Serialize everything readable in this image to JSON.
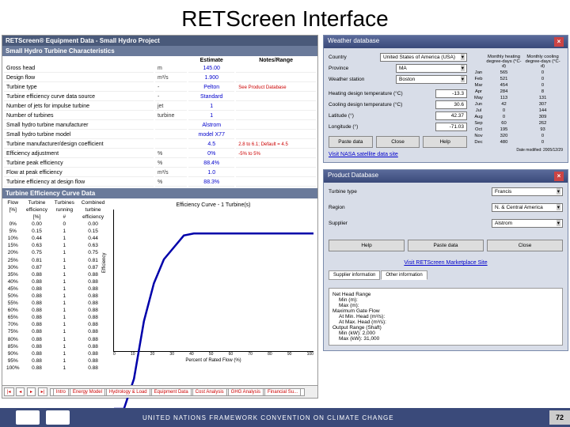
{
  "title": "RETScreen Interface",
  "left_panel": {
    "header": "RETScreen® Equipment Data - Small Hydro Project",
    "section1": "Small Hydro Turbine Characteristics",
    "cols": [
      "",
      "",
      "Estimate",
      "Notes/Range"
    ],
    "rows": [
      {
        "label": "Gross head",
        "unit": "m",
        "val": "145.00",
        "note": ""
      },
      {
        "label": "Design flow",
        "unit": "m³/s",
        "val": "1.900",
        "note": ""
      },
      {
        "label": "Turbine type",
        "unit": "-",
        "val": "Pelton",
        "note": "See Product Database"
      },
      {
        "label": "Turbine efficiency curve data source",
        "unit": "-",
        "val": "Standard",
        "note": ""
      },
      {
        "label": "Number of jets for impulse turbine",
        "unit": "jet",
        "val": "1",
        "note": ""
      },
      {
        "label": "Number of turbines",
        "unit": "turbine",
        "val": "1",
        "note": ""
      },
      {
        "label": "Small hydro turbine manufacturer",
        "unit": "",
        "val": "Alstrom",
        "note": ""
      },
      {
        "label": "Small hydro turbine model",
        "unit": "",
        "val": "model X77",
        "note": ""
      },
      {
        "label": "Turbine manufacturer/design coefficient",
        "unit": "",
        "val": "4.5",
        "note": "2.8 to 6.1; Default = 4.5"
      },
      {
        "label": "Efficiency adjustment",
        "unit": "%",
        "val": "0%",
        "note": "-5% to 5%"
      },
      {
        "label": "Turbine peak efficiency",
        "unit": "%",
        "val": "88.4%",
        "note": ""
      },
      {
        "label": "Flow at peak efficiency",
        "unit": "m³/s",
        "val": "1.0",
        "note": ""
      },
      {
        "label": "Turbine efficiency at design flow",
        "unit": "%",
        "val": "88.3%",
        "note": ""
      }
    ],
    "section2": "Turbine Efficiency Curve Data",
    "eff_headers": [
      "Flow",
      "Turbine",
      "Turbines",
      "Combined"
    ],
    "eff_sub": [
      "[%]",
      "efficiency",
      "running",
      "turbine"
    ],
    "eff_sub2": [
      "",
      "[%]",
      "#",
      "efficiency"
    ],
    "tabs": [
      "Intro",
      "Energy Model",
      "Hydrology & Load",
      "Equipment Data",
      "Cost Analysis",
      "GHG Analysis",
      "Financial Su..."
    ]
  },
  "chart_data": {
    "type": "line",
    "title": "Efficiency Curve - 1 Turbine(s)",
    "xlabel": "Percent of Rated Flow (%)",
    "ylabel": "Efficiency",
    "xlim": [
      0,
      100
    ],
    "ylim": [
      0,
      100
    ],
    "x": [
      0,
      5,
      10,
      15,
      20,
      25,
      30,
      35,
      40,
      45,
      50,
      55,
      60,
      65,
      70,
      75,
      80,
      85,
      90,
      95,
      100
    ],
    "y": [
      0,
      0.0,
      0.15,
      0.44,
      0.63,
      0.75,
      0.81,
      0.87,
      0.88,
      0.88,
      0.88,
      0.88,
      0.88,
      0.88,
      0.88,
      0.88,
      0.88,
      0.88,
      0.88,
      0.88,
      0.88
    ],
    "eff_table": [
      [
        0,
        0.0,
        0,
        0.0
      ],
      [
        5,
        0.15,
        1,
        0.15
      ],
      [
        10,
        0.44,
        1,
        0.44
      ],
      [
        15,
        0.63,
        1,
        0.63
      ],
      [
        20,
        0.75,
        1,
        0.75
      ],
      [
        25,
        0.81,
        1,
        0.81
      ],
      [
        30,
        0.87,
        1,
        0.87
      ],
      [
        35,
        0.88,
        1,
        0.88
      ],
      [
        40,
        0.88,
        1,
        0.88
      ],
      [
        45,
        0.88,
        1,
        0.88
      ],
      [
        50,
        0.88,
        1,
        0.88
      ],
      [
        55,
        0.88,
        1,
        0.88
      ],
      [
        60,
        0.88,
        1,
        0.88
      ],
      [
        65,
        0.88,
        1,
        0.88
      ],
      [
        70,
        0.88,
        1,
        0.88
      ],
      [
        75,
        0.88,
        1,
        0.88
      ],
      [
        80,
        0.88,
        1,
        0.88
      ],
      [
        85,
        0.88,
        1,
        0.88
      ],
      [
        90,
        0.88,
        1,
        0.88
      ],
      [
        95,
        0.88,
        1,
        0.88
      ],
      [
        100,
        0.88,
        1,
        0.88
      ]
    ]
  },
  "weather": {
    "title": "Weather database",
    "country_lbl": "Country",
    "country": "United States of America (USA)",
    "province_lbl": "Province",
    "province": "MA",
    "station_lbl": "Weather station",
    "station": "Boston",
    "heat_lbl": "Heating design temperature (°C)",
    "heat": "-13.3",
    "cool_lbl": "Cooling design temperature (°C)",
    "cool": "30.6",
    "lat_lbl": "Latitude (°)",
    "lat": "42.37",
    "lon_lbl": "Longitude (°)",
    "lon": "-71.03",
    "btn_paste": "Paste data",
    "btn_close": "Close",
    "btn_help": "Help",
    "link": "Visit NASA satellite data site",
    "modified": "Date modified: 2005/12/29",
    "data_cols": [
      "",
      "Monthly heating degree-days (°C-d)",
      "Monthly cooling degree-days (°C-d)"
    ],
    "data": [
      [
        "Jan",
        565,
        0
      ],
      [
        "Feb",
        521,
        0
      ],
      [
        "Mar",
        454,
        0
      ],
      [
        "Apr",
        284,
        8
      ],
      [
        "May",
        113,
        131
      ],
      [
        "Jun",
        42,
        307
      ],
      [
        "Jul",
        0,
        144
      ],
      [
        "Aug",
        0,
        309
      ],
      [
        "Sep",
        60,
        262
      ],
      [
        "Oct",
        195,
        93
      ],
      [
        "Nov",
        320,
        0
      ],
      [
        "Dec",
        480,
        0
      ]
    ]
  },
  "product_db": {
    "title": "Product Database",
    "type_lbl": "Turbine type",
    "type": "Francis",
    "region_lbl": "Region",
    "region": "N. & Central America",
    "supplier_lbl": "Supplier",
    "supplier": "Alstrom",
    "btn_help": "Help",
    "btn_paste": "Paste data",
    "btn_close": "Close",
    "link": "Visit RETScreen Marketplace Site",
    "tab1": "Supplier information",
    "tab2": "Other information",
    "info": [
      "Net Head Range",
      "  Min (m):",
      "  Max (m):",
      "Maximum Gate Flow",
      "  At Min. Head (m³/s):",
      "  At Max. Head (m³/s):",
      "Output Range (Shaft)",
      "  Min (kW): 2,000",
      "  Max (kW): 31,000"
    ]
  },
  "footer": {
    "text": "UNITED NATIONS FRAMEWORK CONVENTION ON CLIMATE CHANGE",
    "page": "72"
  }
}
